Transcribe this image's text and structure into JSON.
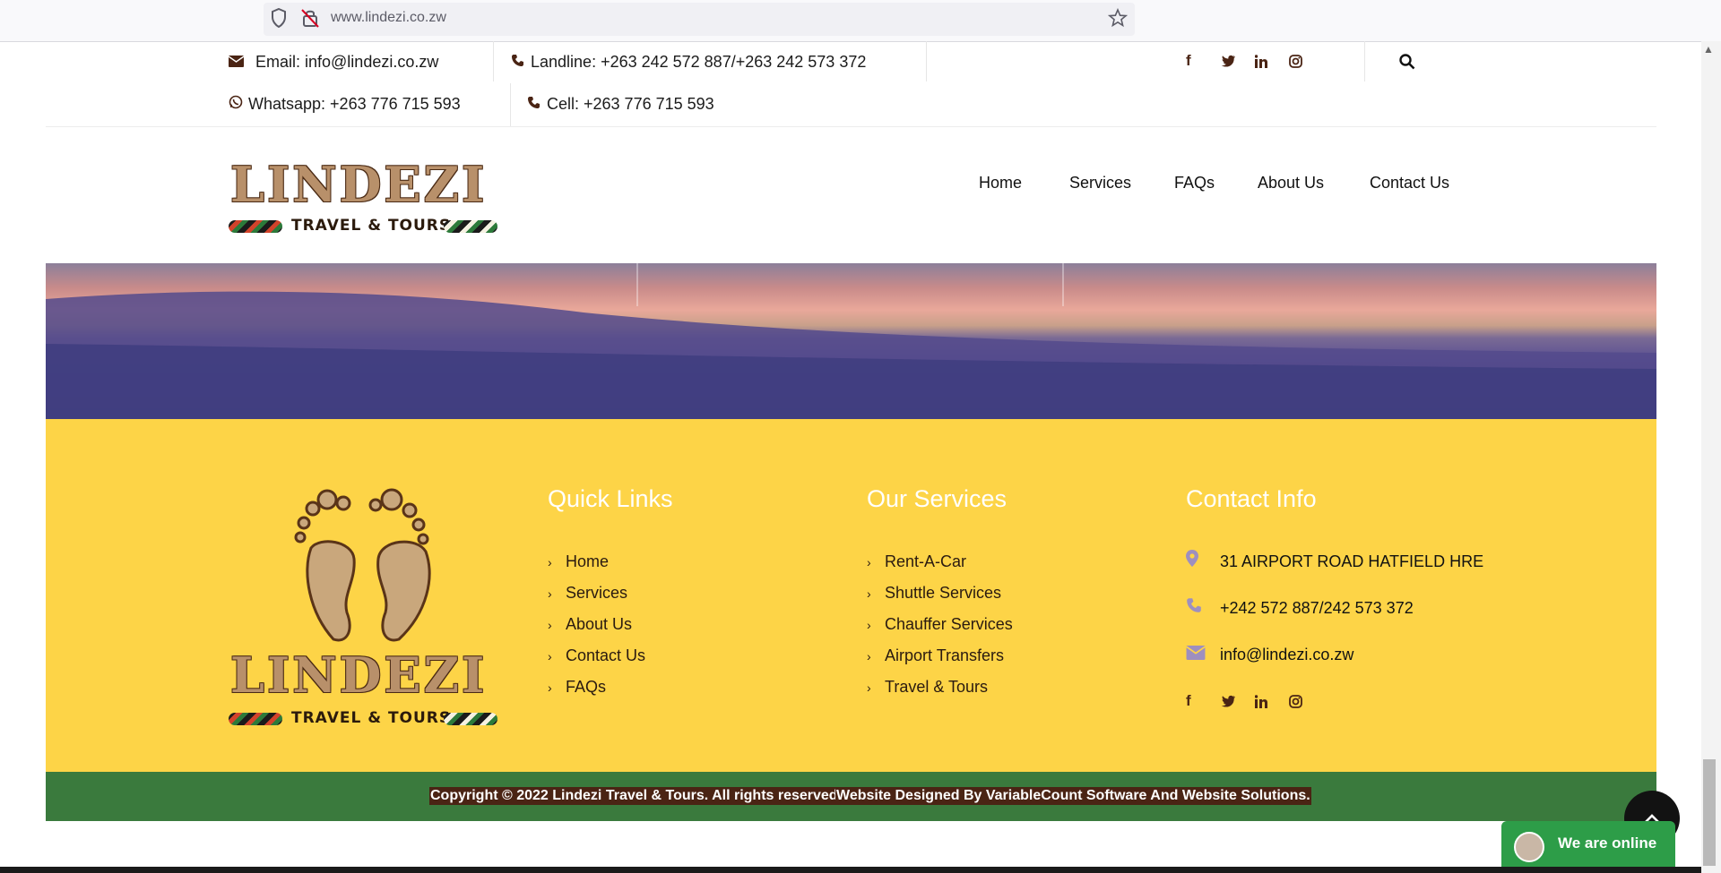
{
  "browser": {
    "url": "www.lindezi.co.zw",
    "icons": [
      "shield-icon",
      "no-lock-icon",
      "bookmark-star-icon"
    ]
  },
  "topbar": {
    "email": "Email: info@lindezi.co.zw",
    "landline": "Landline: +263 242 572 887/+263 242 573 372",
    "whatsapp": "Whatsapp: +263 776 715 593",
    "cell": "Cell: +263 776 715 593",
    "social_icons": [
      "facebook-icon",
      "twitter-icon",
      "linkedin-icon",
      "instagram-icon"
    ],
    "search_icon": "search-icon"
  },
  "logo": {
    "word": "LINDEZI",
    "tagline": "TRAVEL & TOURS"
  },
  "nav": {
    "items": [
      "Home",
      "Services",
      "FAQs",
      "About Us",
      "Contact Us"
    ]
  },
  "footer": {
    "quick_links": {
      "title": "Quick Links",
      "items": [
        "Home",
        "Services",
        "About Us",
        "Contact Us",
        "FAQs"
      ]
    },
    "services": {
      "title": "Our Services",
      "items": [
        "Rent-A-Car",
        "Shuttle Services",
        "Chauffer Services",
        "Airport Transfers",
        "Travel & Tours"
      ]
    },
    "contact": {
      "title": "Contact Info",
      "address": "31 AIRPORT ROAD HATFIELD HRE",
      "phone": "+242 572 887/242 573 372",
      "email": "info@lindezi.co.zw"
    },
    "copyright": "Copyright © 2022 Lindezi Travel & Tours. All rights reserved.",
    "designer": "Website Designed By VariableCount Software And Website Solutions."
  },
  "chat": {
    "label": "We are online"
  },
  "colors": {
    "footer_bg": "#fdd447",
    "copyright_bg": "#3a7a3d",
    "chat_bg": "#2d9d48",
    "icon_brown": "#4a2414",
    "contact_icon": "#9e8fbf"
  }
}
